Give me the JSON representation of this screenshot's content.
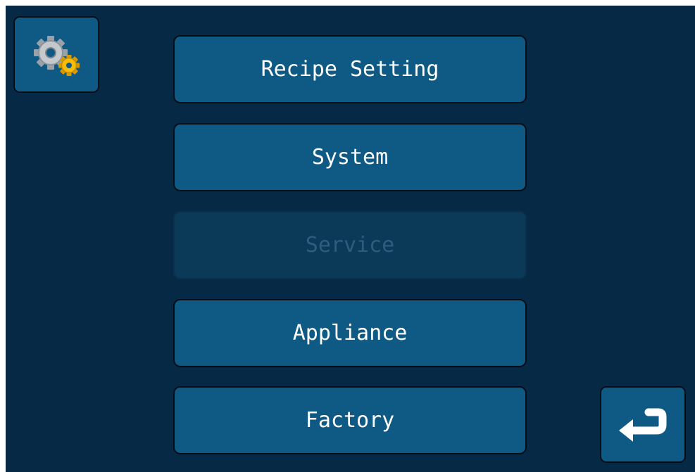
{
  "menu": {
    "items": [
      {
        "label": "Recipe Setting",
        "enabled": true
      },
      {
        "label": "System",
        "enabled": true
      },
      {
        "label": "Service",
        "enabled": false
      },
      {
        "label": "Appliance",
        "enabled": true
      },
      {
        "label": "Factory",
        "enabled": true
      }
    ]
  },
  "icons": {
    "settings": "gears-icon",
    "back": "return-arrow-icon"
  },
  "colors": {
    "background": "#062a45",
    "button": "#0f5a84",
    "button_disabled": "#0b3a59",
    "text": "#ffffff",
    "text_disabled": "#2e5c7d",
    "gear_gray": "#b9bec4",
    "gear_gold": "#f0b800"
  }
}
